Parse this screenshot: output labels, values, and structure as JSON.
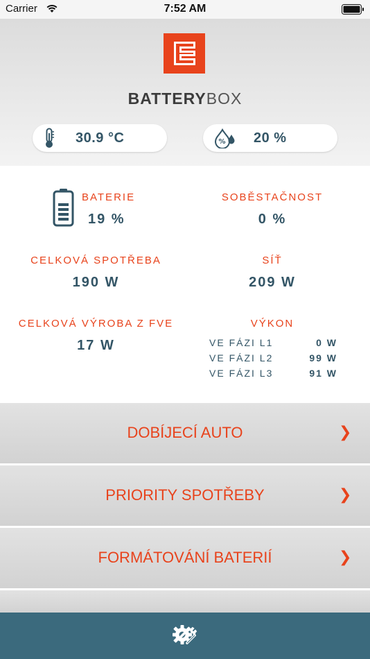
{
  "status_bar": {
    "carrier": "Carrier",
    "time": "7:52 AM"
  },
  "header": {
    "brand_bold": "BATTERY",
    "brand_light": "BOX",
    "temperature": "30.9 °C",
    "humidity": "20 %"
  },
  "stats": {
    "battery": {
      "label": "BATERIE",
      "value": "19 %"
    },
    "self_sufficiency": {
      "label": "SOBĚSTAČNOST",
      "value": "0 %"
    },
    "total_consumption": {
      "label": "CELKOVÁ SPOTŘEBA",
      "value": "190 W"
    },
    "grid": {
      "label": "SÍŤ",
      "value": "209 W"
    },
    "pv_production": {
      "label": "CELKOVÁ VÝROBA Z FVE",
      "value": "17 W"
    },
    "power": {
      "label": "VÝKON",
      "phases": [
        {
          "label": "VE FÁZI L1",
          "value": "0 W"
        },
        {
          "label": "VE FÁZI L2",
          "value": "99 W"
        },
        {
          "label": "VE FÁZI L3",
          "value": "91 W"
        }
      ]
    }
  },
  "menu": {
    "items": [
      {
        "label": "DOBÍJECÍ AUTO",
        "chevron": "❯"
      },
      {
        "label": "PRIORITY SPOTŘEBY",
        "chevron": "❯"
      },
      {
        "label": "FORMÁTOVÁNÍ BATERIÍ",
        "chevron": "❯"
      }
    ]
  },
  "icons": {
    "wifi": "wifi-icon",
    "battery_status": "battery-status-icon",
    "logo": "cez-logo",
    "thermometer": "thermometer-icon",
    "humidity": "humidity-icon",
    "battery": "battery-icon",
    "settings": "settings-icon"
  },
  "colors": {
    "accent": "#e8431c",
    "value_text": "#335566",
    "bottom_bar": "#3b6a7d"
  }
}
